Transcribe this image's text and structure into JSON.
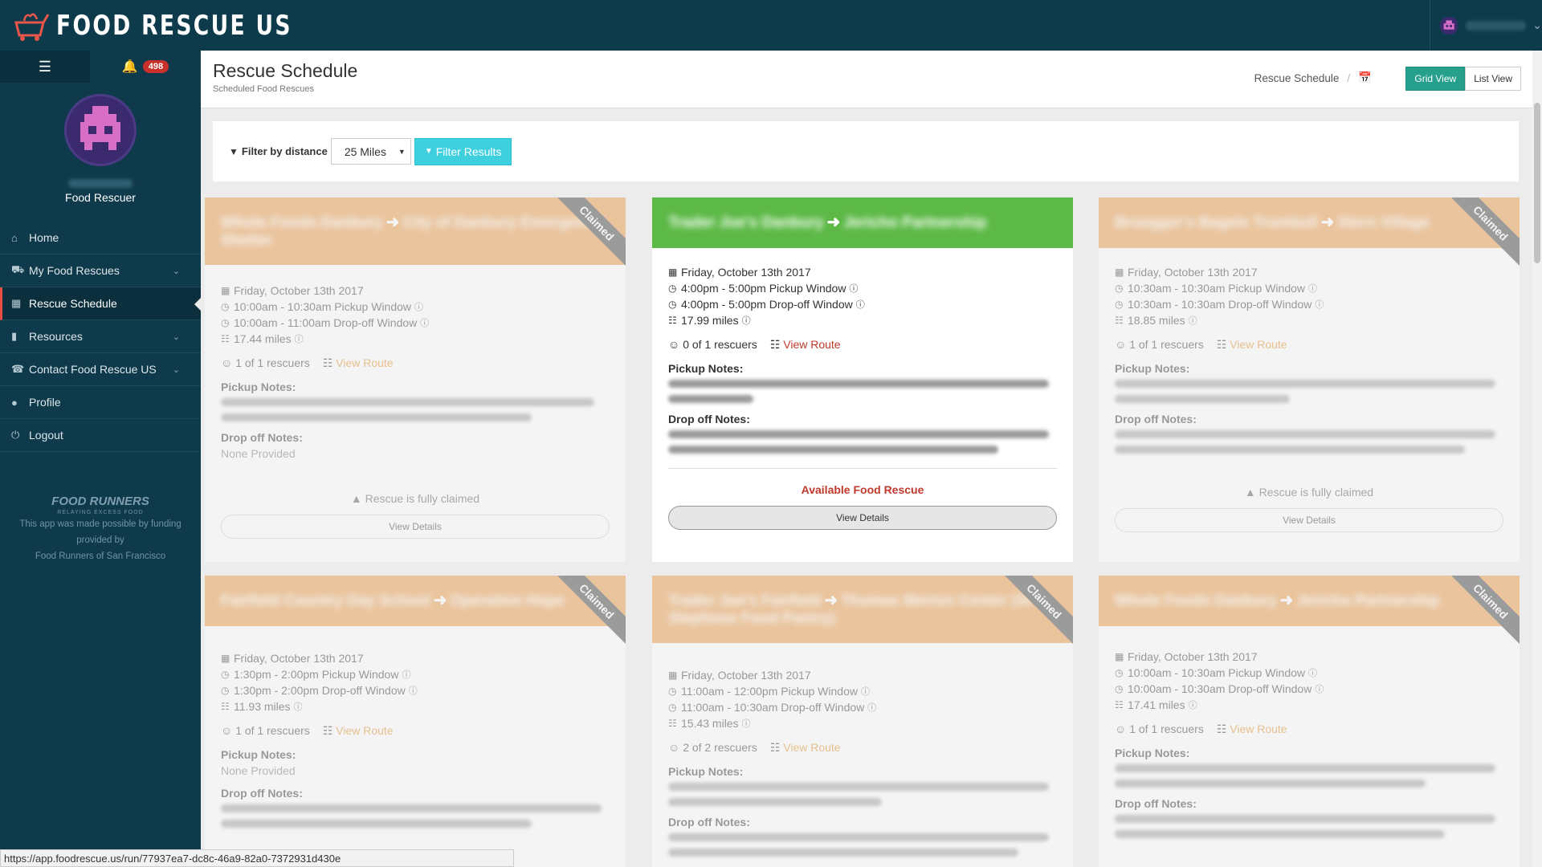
{
  "app": {
    "brand": "FOOD RESCUE US",
    "notifications": "498"
  },
  "user": {
    "role": "Food Rescuer"
  },
  "nav": {
    "items": [
      {
        "label": "Home",
        "icon": "home-icon"
      },
      {
        "label": "My Food Rescues",
        "icon": "car-icon"
      },
      {
        "label": "Rescue Schedule",
        "icon": "calendar-icon"
      },
      {
        "label": "Resources",
        "icon": "book-icon"
      },
      {
        "label": "Contact Food Rescue US",
        "icon": "phone-icon"
      },
      {
        "label": "Profile",
        "icon": "user-icon"
      },
      {
        "label": "Logout",
        "icon": "power-icon"
      }
    ]
  },
  "sponsor": {
    "logo": "FOOD RUNNERS",
    "tagline": "RELAYING EXCESS FOOD",
    "line1": "This app was made possible by funding",
    "line2": "provided by",
    "line3": "Food Runners of San Francisco"
  },
  "page": {
    "title": "Rescue Schedule",
    "subtitle": "Scheduled Food Rescues",
    "breadcrumb": "Rescue Schedule",
    "grid_view": "Grid View",
    "list_view": "List View"
  },
  "filter": {
    "label": "Filter by distance",
    "selected": "25 Miles",
    "button": "Filter Results"
  },
  "cards": [
    {
      "date": "Friday, October 13th 2017",
      "pickup": "10:00am - 10:30am Pickup Window",
      "dropoff": "10:00am - 11:00am Drop-off Window",
      "miles": "17.44 miles",
      "rescuers": "1 of 1 rescuers",
      "route": "View Route",
      "pickup_label": "Pickup Notes:",
      "drop_label": "Drop off Notes:",
      "drop_notes": "None Provided",
      "status": "Rescue is fully claimed",
      "details": "View Details",
      "ribbon": "Claimed"
    },
    {
      "date": "Friday, October 13th 2017",
      "pickup": "4:00pm - 5:00pm Pickup Window",
      "dropoff": "4:00pm - 5:00pm Drop-off Window",
      "miles": "17.99 miles",
      "rescuers": "0 of 1 rescuers",
      "route": "View Route",
      "pickup_label": "Pickup Notes:",
      "drop_label": "Drop off Notes:",
      "status": "Available Food Rescue",
      "details": "View Details"
    },
    {
      "date": "Friday, October 13th 2017",
      "pickup": "10:30am - 10:30am Pickup Window",
      "dropoff": "10:30am - 10:30am Drop-off Window",
      "miles": "18.85 miles",
      "rescuers": "1 of 1 rescuers",
      "route": "View Route",
      "pickup_label": "Pickup Notes:",
      "drop_label": "Drop off Notes:",
      "status": "Rescue is fully claimed",
      "details": "View Details",
      "ribbon": "Claimed"
    },
    {
      "date": "Friday, October 13th 2017",
      "pickup": "1:30pm - 2:00pm Pickup Window",
      "dropoff": "1:30pm - 2:00pm Drop-off Window",
      "miles": "11.93 miles",
      "rescuers": "1 of 1 rescuers",
      "route": "View Route",
      "pickup_label": "Pickup Notes:",
      "pickup_notes": "None Provided",
      "drop_label": "Drop off Notes:",
      "ribbon": "Claimed"
    },
    {
      "date": "Friday, October 13th 2017",
      "pickup": "11:00am - 12:00pm Pickup Window",
      "dropoff": "11:00am - 10:30am Drop-off Window",
      "miles": "15.43 miles",
      "rescuers": "2 of 2 rescuers",
      "route": "View Route",
      "pickup_label": "Pickup Notes:",
      "drop_label": "Drop off Notes:",
      "ribbon": "Claimed"
    },
    {
      "date": "Friday, October 13th 2017",
      "pickup": "10:00am - 10:30am Pickup Window",
      "dropoff": "10:00am - 10:30am Drop-off Window",
      "miles": "17.41 miles",
      "rescuers": "1 of 1 rescuers",
      "route": "View Route",
      "pickup_label": "Pickup Notes:",
      "drop_label": "Drop off Notes:",
      "ribbon": "Claimed"
    }
  ],
  "statusbar": {
    "url": "https://app.foodrescue.us/run/77937ea7-dc8c-46a9-82a0-7372931d430e"
  },
  "colors": {
    "topbar": "#0e3b4c",
    "claimed_header": "#e8953f",
    "available_header": "#5cb946",
    "accent": "#26a08d",
    "filter_button": "#3fd0e0"
  }
}
